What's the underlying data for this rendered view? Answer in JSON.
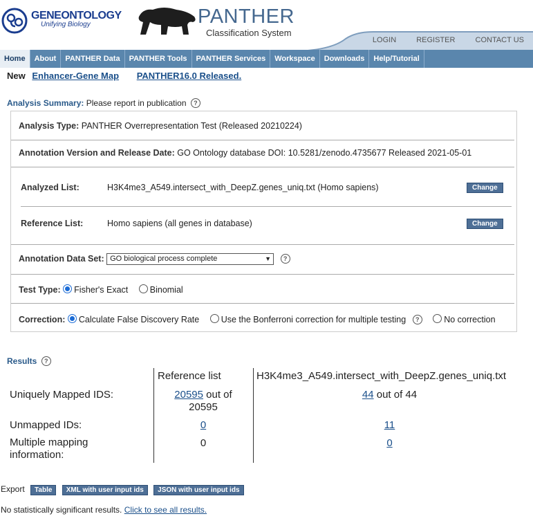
{
  "header": {
    "go_title": "GENEONTOLOGY",
    "go_subtitle": "Unifying Biology",
    "panther_title": "PANTHER",
    "panther_subtitle": "Classification System",
    "top_links": [
      "LOGIN",
      "REGISTER",
      "CONTACT US"
    ]
  },
  "nav": {
    "items": [
      "Home",
      "About",
      "PANTHER Data",
      "PANTHER Tools",
      "PANTHER Services",
      "Workspace",
      "Downloads",
      "Help/Tutorial"
    ],
    "active": "Home"
  },
  "news": {
    "label": "New",
    "link1": "Enhancer-Gene Map",
    "link2": "PANTHER16.0 Released."
  },
  "summary": {
    "title_label": "Analysis Summary:",
    "title_note": "Please report in publication",
    "analysis_type_label": "Analysis Type:",
    "analysis_type_value": "PANTHER Overrepresentation Test (Released 20210224)",
    "annotation_version_label": "Annotation Version and Release Date:",
    "annotation_version_value": "GO Ontology database DOI: 10.5281/zenodo.4735677 Released 2021-05-01",
    "analyzed_list_label": "Analyzed List:",
    "analyzed_list_value": "H3K4me3_A549.intersect_with_DeepZ.genes_uniq.txt (Homo sapiens)",
    "reference_list_label": "Reference List:",
    "reference_list_value": "Homo sapiens (all genes in database)",
    "change_label": "Change",
    "annotation_dataset_label": "Annotation Data Set:",
    "annotation_dataset_selected": "GO biological process complete",
    "test_type_label": "Test Type:",
    "test_type_options": [
      "Fisher's Exact",
      "Binomial"
    ],
    "correction_label": "Correction:",
    "correction_options": [
      "Calculate False Discovery Rate",
      "Use the Bonferroni correction for multiple testing",
      "No correction"
    ]
  },
  "results": {
    "title": "Results",
    "col_reference": "Reference list",
    "col_analyzed": "H3K4me3_A549.intersect_with_DeepZ.genes_uniq.txt",
    "row1_label": "Uniquely Mapped IDS:",
    "row1_ref_link": "20595",
    "row1_ref_text1": " out of",
    "row1_ref_text2": "20595",
    "row1_an_link": "44",
    "row1_an_text": " out of 44",
    "row2_label": "Unmapped IDs:",
    "row2_ref": "0",
    "row2_an": "11",
    "row3_label1": "Multiple mapping",
    "row3_label2": "information:",
    "row3_ref": "0",
    "row3_an": "0"
  },
  "export": {
    "label": "Export",
    "buttons": [
      "Table",
      "XML with user input ids",
      "JSON with user input ids"
    ]
  },
  "footer": {
    "text": "No statistically significant results.",
    "link": "Click to see all results."
  }
}
